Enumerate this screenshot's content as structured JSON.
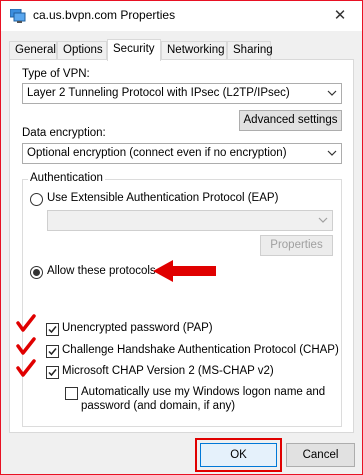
{
  "window": {
    "title": "ca.us.bvpn.com Properties",
    "close_glyph": "✕"
  },
  "tabs": [
    {
      "label": "General"
    },
    {
      "label": "Options"
    },
    {
      "label": "Security"
    },
    {
      "label": "Networking"
    },
    {
      "label": "Sharing"
    }
  ],
  "active_tab": "Security",
  "security": {
    "vpn_type_label": "Type of VPN:",
    "vpn_type_value": "Layer 2 Tunneling Protocol with IPsec (L2TP/IPsec)",
    "advanced_button": "Advanced settings",
    "encryption_label": "Data encryption:",
    "encryption_value": "Optional encryption (connect even if no encryption)",
    "auth_group_label": "Authentication",
    "eap_radio_label": "Use Extensible Authentication Protocol (EAP)",
    "eap_selected": false,
    "eap_combo_value": "",
    "properties_button": "Properties",
    "allow_radio_label": "Allow these protocols",
    "allow_selected": true,
    "protocols": [
      {
        "label": "Unencrypted password (PAP)",
        "checked": true
      },
      {
        "label": "Challenge Handshake Authentication Protocol (CHAP)",
        "checked": true
      },
      {
        "label": "Microsoft CHAP Version 2 (MS-CHAP v2)",
        "checked": true
      }
    ],
    "auto_logon_line1": "Automatically use my Windows logon name and",
    "auto_logon_line2": "password (and domain, if any)",
    "auto_logon_checked": false
  },
  "footer": {
    "ok_label": "OK",
    "cancel_label": "Cancel"
  },
  "colors": {
    "annotation_red": "#e00000",
    "window_border": "#e81123",
    "ok_button_border": "#0078d7"
  }
}
